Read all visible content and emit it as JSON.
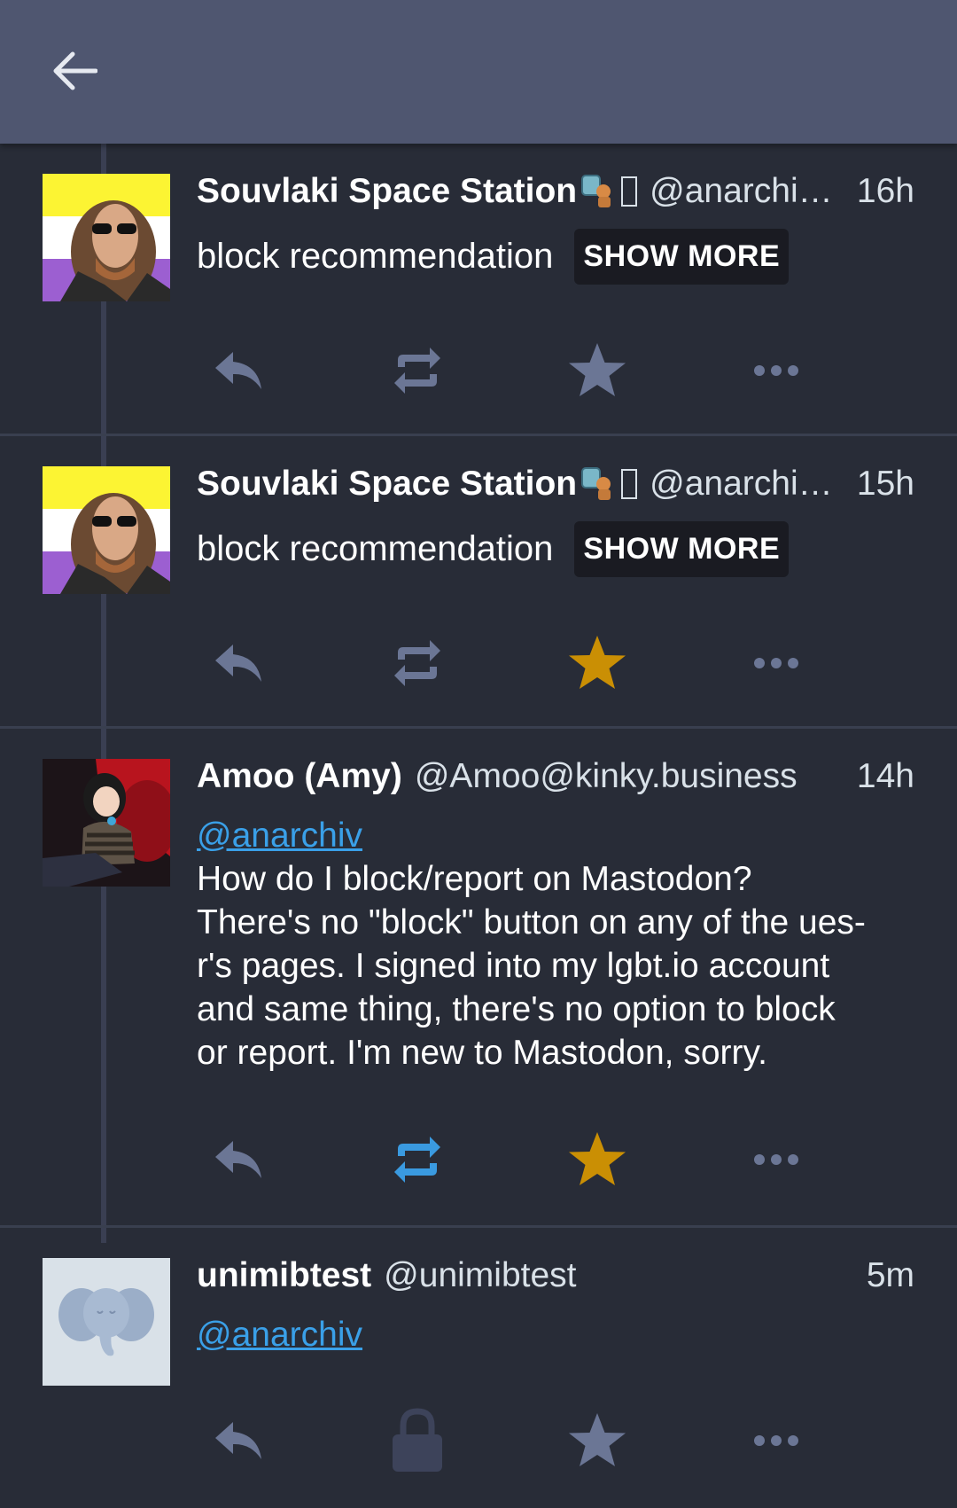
{
  "colors": {
    "icon_default": "#6b7695",
    "favourited": "#ca8f04",
    "boosted": "#3a9ae0",
    "mention": "#3aa0e8"
  },
  "statuses": [
    {
      "display_name": "Souvlaki Space Station",
      "handle": "@anarchi…",
      "time": "16h",
      "spoiler_text": "block recommendation",
      "show_more_label": "SHOW MORE",
      "favourited": false,
      "boosted": false
    },
    {
      "display_name": "Souvlaki Space Station",
      "handle": "@anarchi…",
      "time": "15h",
      "spoiler_text": "block recommendation",
      "show_more_label": "SHOW MORE",
      "favourited": true,
      "boosted": false
    },
    {
      "display_name": "Amoo (Amy)",
      "handle": "@Amoo@kinky.business",
      "time": "14h",
      "mention": "@anarchiv",
      "text_lines": [
        "How do I block/report on Mastodon?",
        "There's no \"block\" button on any of the ues-",
        "r's pages. I signed into my lgbt.io account",
        "and same thing, there's no option to block",
        "or report. I'm new to Mastodon, sorry."
      ],
      "favourited": true,
      "boosted": true
    },
    {
      "display_name": "unimibtest",
      "handle": "@unimibtest",
      "time": "5m",
      "mention": "@anarchiv",
      "favourited": false,
      "boosted": false,
      "boost_locked": true
    }
  ]
}
